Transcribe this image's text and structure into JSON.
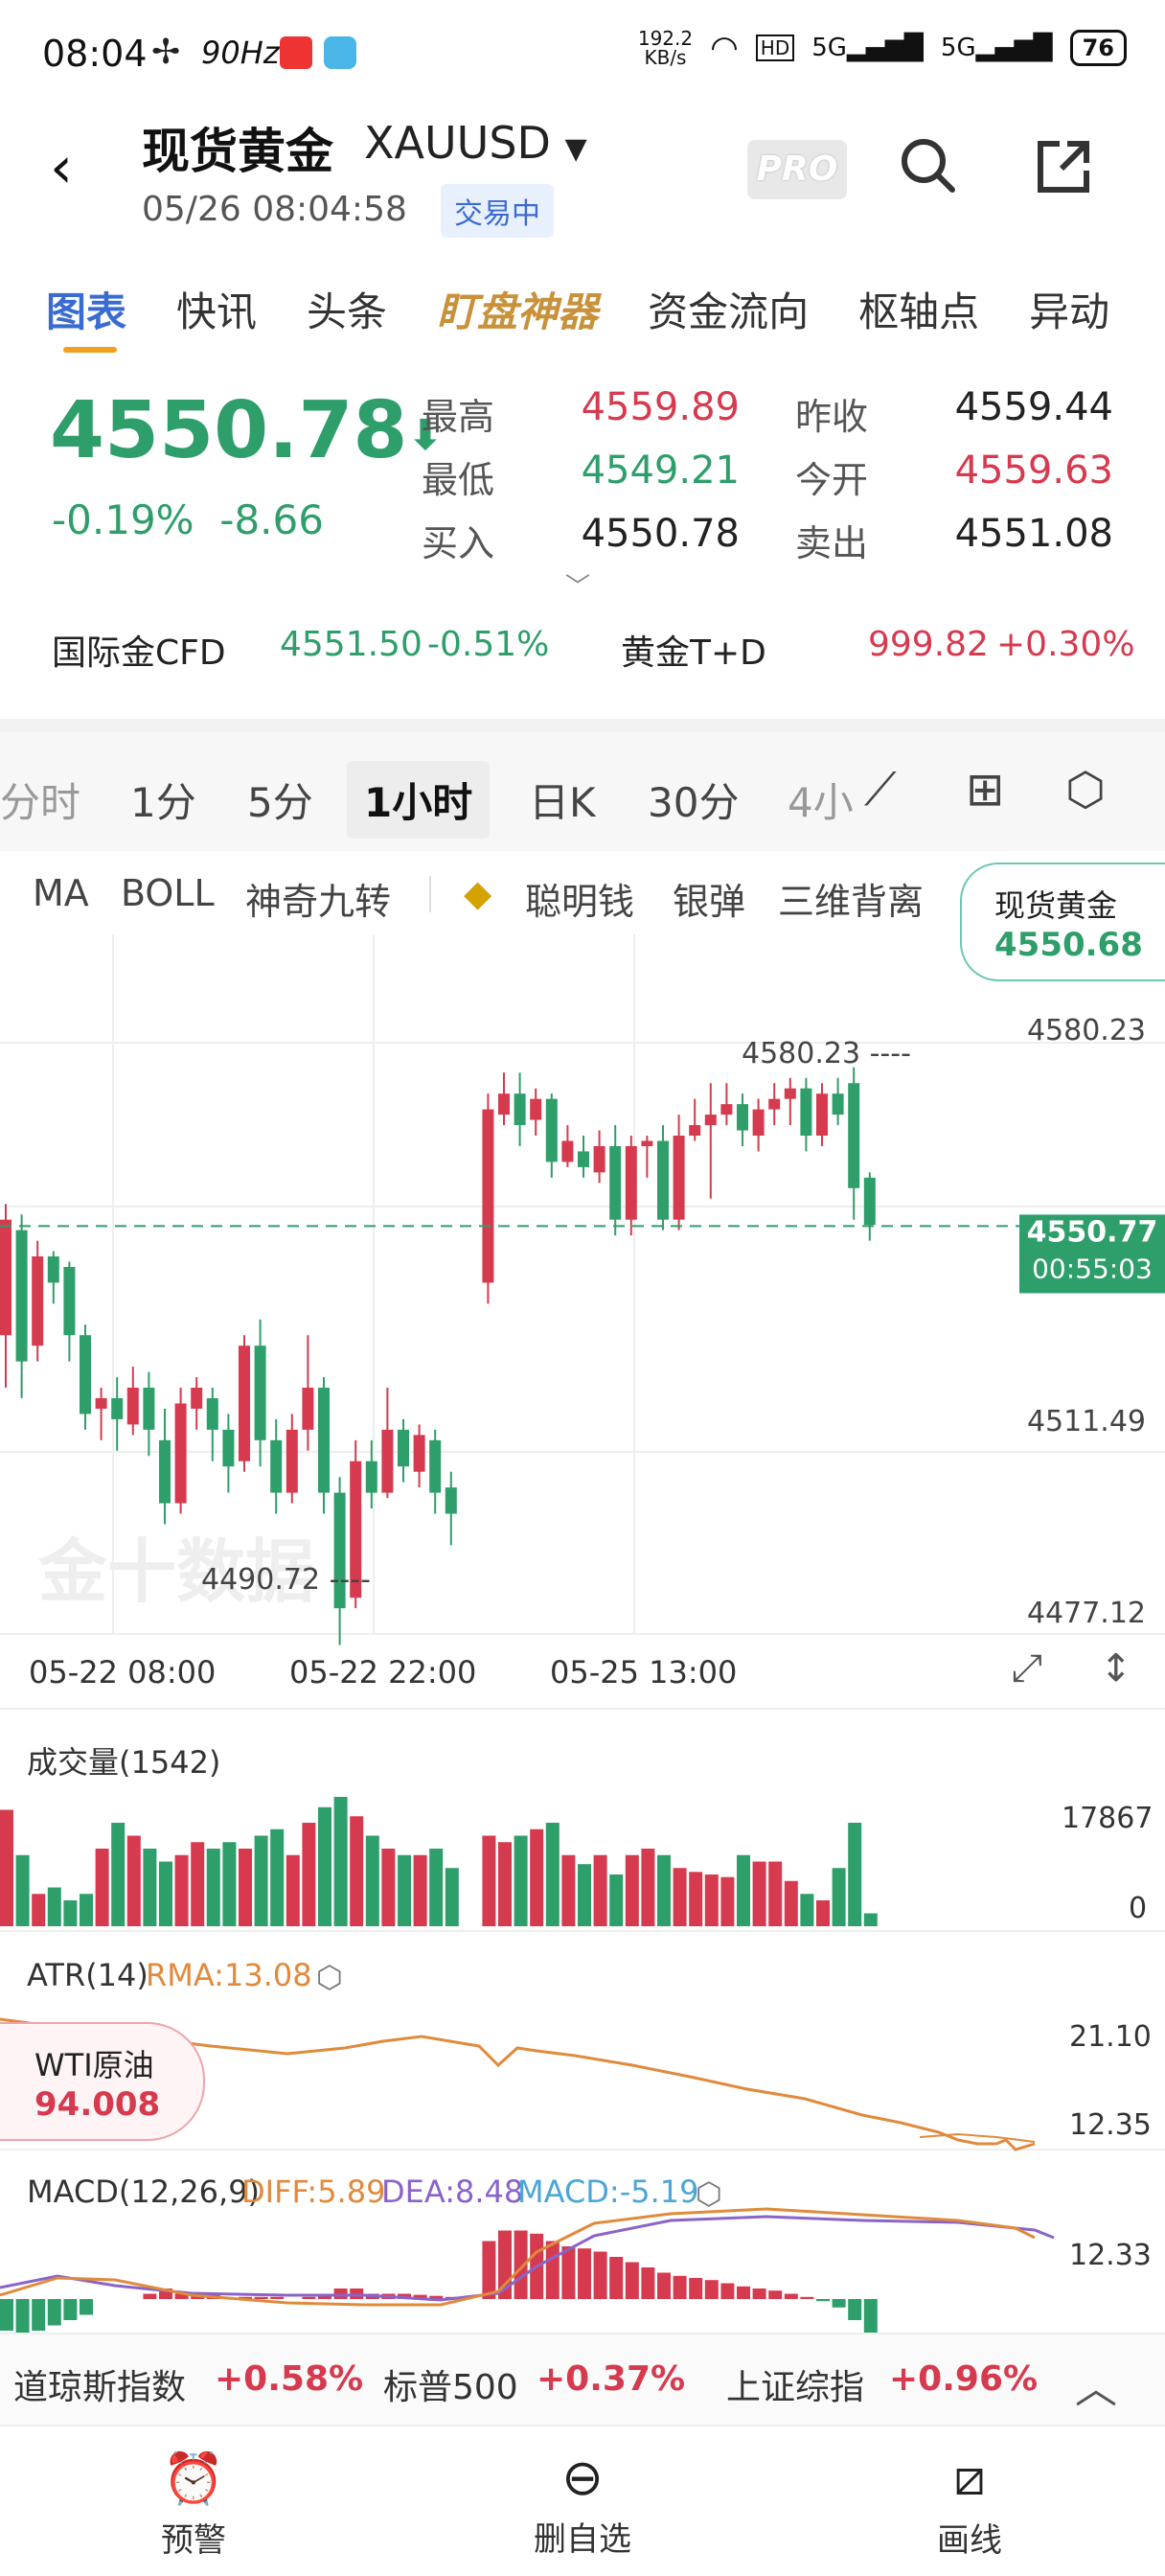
{
  "status": {
    "time": "08:04",
    "hz": "90Hz",
    "speed": "192.2\nKB/s",
    "battery": "76"
  },
  "header": {
    "title": "现货黄金",
    "symbol": "XAUUSD",
    "datetime": "05/26 08:04:58",
    "badge": "交易中",
    "pro_label": "PRO"
  },
  "tabs": [
    "图表",
    "快讯",
    "头条",
    "盯盘神器",
    "资金流向",
    "枢轴点",
    "异动"
  ],
  "quote": {
    "price": "4550.78",
    "change_pct": "-0.19%",
    "change": "-8.66",
    "high_label": "最高",
    "high": "4559.89",
    "low_label": "最低",
    "low": "4549.21",
    "bid_label": "买入",
    "bid": "4550.78",
    "prev_label": "昨收",
    "prev": "4559.44",
    "open_label": "今开",
    "open": "4559.63",
    "ask_label": "卖出",
    "ask": "4551.08"
  },
  "related": {
    "cfd_label": "国际金CFD",
    "cfd_price": "4551.50",
    "cfd_pct": "-0.51%",
    "td_label": "黄金T+D",
    "td_price": "999.82",
    "td_pct": "+0.30%"
  },
  "periods": [
    "分时",
    "1分",
    "5分",
    "1小时",
    "日K",
    "30分",
    "4小"
  ],
  "indicators": [
    "MA",
    "BOLL",
    "神奇九转",
    "聪明钱",
    "银弹",
    "三维背离"
  ],
  "floating_quote": {
    "label": "现货黄金",
    "value": "4550.68"
  },
  "chart": {
    "y_labels": [
      "4580.23",
      "4511.49",
      "4477.12"
    ],
    "high_marker": "4580.23",
    "low_marker": "4490.72",
    "current": "4550.77",
    "countdown": "00:55:03",
    "dates": [
      "05-22 08:00",
      "05-22 22:00",
      "05-25 13:00"
    ],
    "watermark": "金十数据"
  },
  "volume": {
    "title": "成交量(1542)",
    "max": "17867",
    "min": "0"
  },
  "atr": {
    "title": "ATR(14)",
    "rma": "RMA:13.08",
    "max": "21.10",
    "min": "12.35"
  },
  "wti": {
    "label": "WTI原油",
    "value": "94.008"
  },
  "macd": {
    "title": "MACD(12,26,9)",
    "diff": "DIFF:5.89",
    "dea": "DEA:8.48",
    "macd": "MACD:-5.19",
    "max": "12.33"
  },
  "ticker": [
    {
      "name": "道琼斯指数",
      "pct": "+0.58%"
    },
    {
      "name": "标普500",
      "pct": "+0.37%"
    },
    {
      "name": "上证综指",
      "pct": "+0.96%"
    }
  ],
  "nav": [
    "预警",
    "删自选",
    "画线"
  ],
  "colors": {
    "up": "#d63a4e",
    "down": "#2e9e6a",
    "accent": "#3a6bd1"
  }
}
